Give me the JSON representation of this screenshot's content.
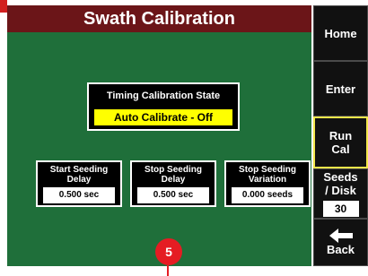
{
  "title": "Swath Calibration",
  "sidebar": {
    "home": "Home",
    "enter": "Enter",
    "run_cal_line1": "Run",
    "run_cal_line2": "Cal",
    "seeds_line1": "Seeds",
    "seeds_line2": "/ Disk",
    "seeds_value": "30",
    "back": "Back"
  },
  "timing": {
    "label": "Timing Calibration State",
    "value": "Auto Calibrate - Off"
  },
  "params": [
    {
      "label_line1": "Start Seeding",
      "label_line2": "Delay",
      "value": "0.500 sec"
    },
    {
      "label_line1": "Stop Seeding",
      "label_line2": "Delay",
      "value": "0.500 sec"
    },
    {
      "label_line1": "Stop Seeding",
      "label_line2": "Variation",
      "value": "0.000 seeds"
    }
  ],
  "callout": "5",
  "colors": {
    "title_bar": "#6b1518",
    "panel": "#1f6f3a",
    "highlight": "#ffff00",
    "callout": "#e51c23"
  }
}
